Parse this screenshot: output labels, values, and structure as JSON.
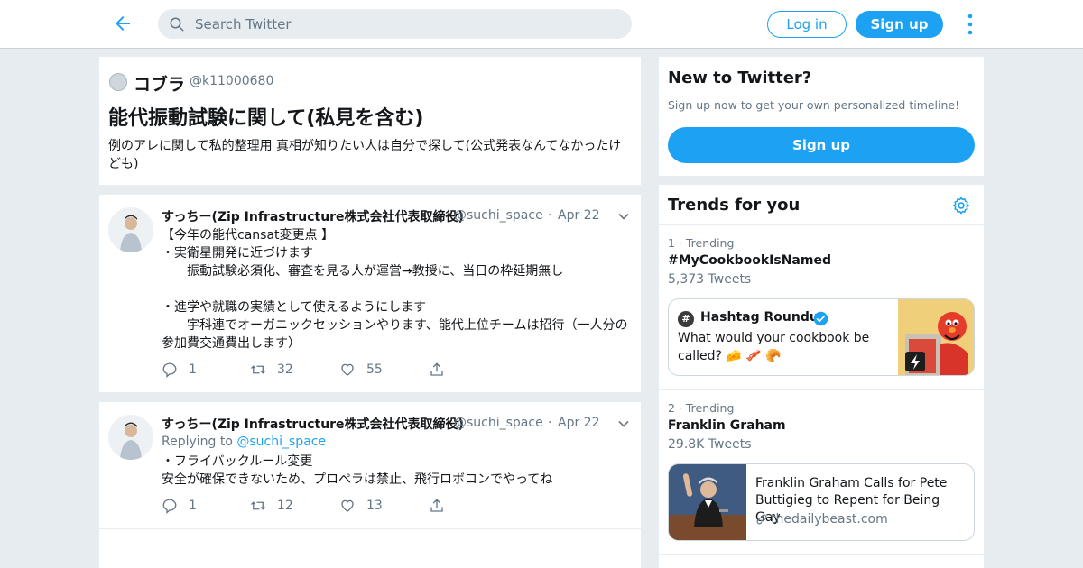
{
  "topbar": {
    "search_placeholder": "Search Twitter",
    "login_label": "Log in",
    "signup_label": "Sign up"
  },
  "moment": {
    "author_name": "コブラ",
    "author_handle": "@k11000680",
    "title": "能代振動試験に関して(私見を含む)",
    "description": "例のアレに関して私的整理用 真相が知りたい人は自分で探して(公式発表なんてなかったけども)"
  },
  "tweets": [
    {
      "name": "すっちー(Zip Infrastructure株式会社代表取締役)",
      "handle": "@suchi_space",
      "dot": "·",
      "date": "Apr 22",
      "text": "【今年の能代cansat変更点 】\n・実衛星開発に近づけます\n　　振動試験必須化、審査を見る人が運営→教授に、当日の枠延期無し\n\n・進学や就職の実績として使えるようにします\n　　宇科連でオーガニックセッションやります、能代上位チームは招待（一人分の参加費交通費出します）",
      "replies": "1",
      "retweets": "32",
      "likes": "55"
    },
    {
      "name": "すっちー(Zip Infrastructure株式会社代表取締役)",
      "handle": "@suchi_space",
      "dot": "·",
      "date": "Apr 22",
      "replying_prefix": "Replying to ",
      "replying_to": "@suchi_space",
      "text": "・フライバックルール変更\n安全が確保できないため、プロペラは禁止、飛行ロボコンでやってね",
      "replies": "1",
      "retweets": "12",
      "likes": "13"
    }
  ],
  "new_to_twitter": {
    "heading": "New to Twitter?",
    "subtext": "Sign up now to get your own personalized timeline!",
    "button": "Sign up"
  },
  "trends": {
    "heading": "Trends for you",
    "items": [
      {
        "meta": "1 · Trending",
        "name": "#MyCookbookIsNamed",
        "count": "5,373 Tweets",
        "card": {
          "source_name": "Hashtag Roundup",
          "source_icon": "#",
          "text": "What would your cookbook be called? 🧀 🥓 🥐"
        }
      },
      {
        "meta": "2 · Trending",
        "name": "Franklin Graham",
        "count": "29.8K Tweets",
        "card": {
          "title": "Franklin Graham Calls for Pete Buttigieg to Repent for Being Gay",
          "url": "thedailybeast.com"
        }
      }
    ]
  },
  "colors": {
    "accent": "#1da1f2",
    "background": "#e6ecf0",
    "muted": "#657786"
  }
}
